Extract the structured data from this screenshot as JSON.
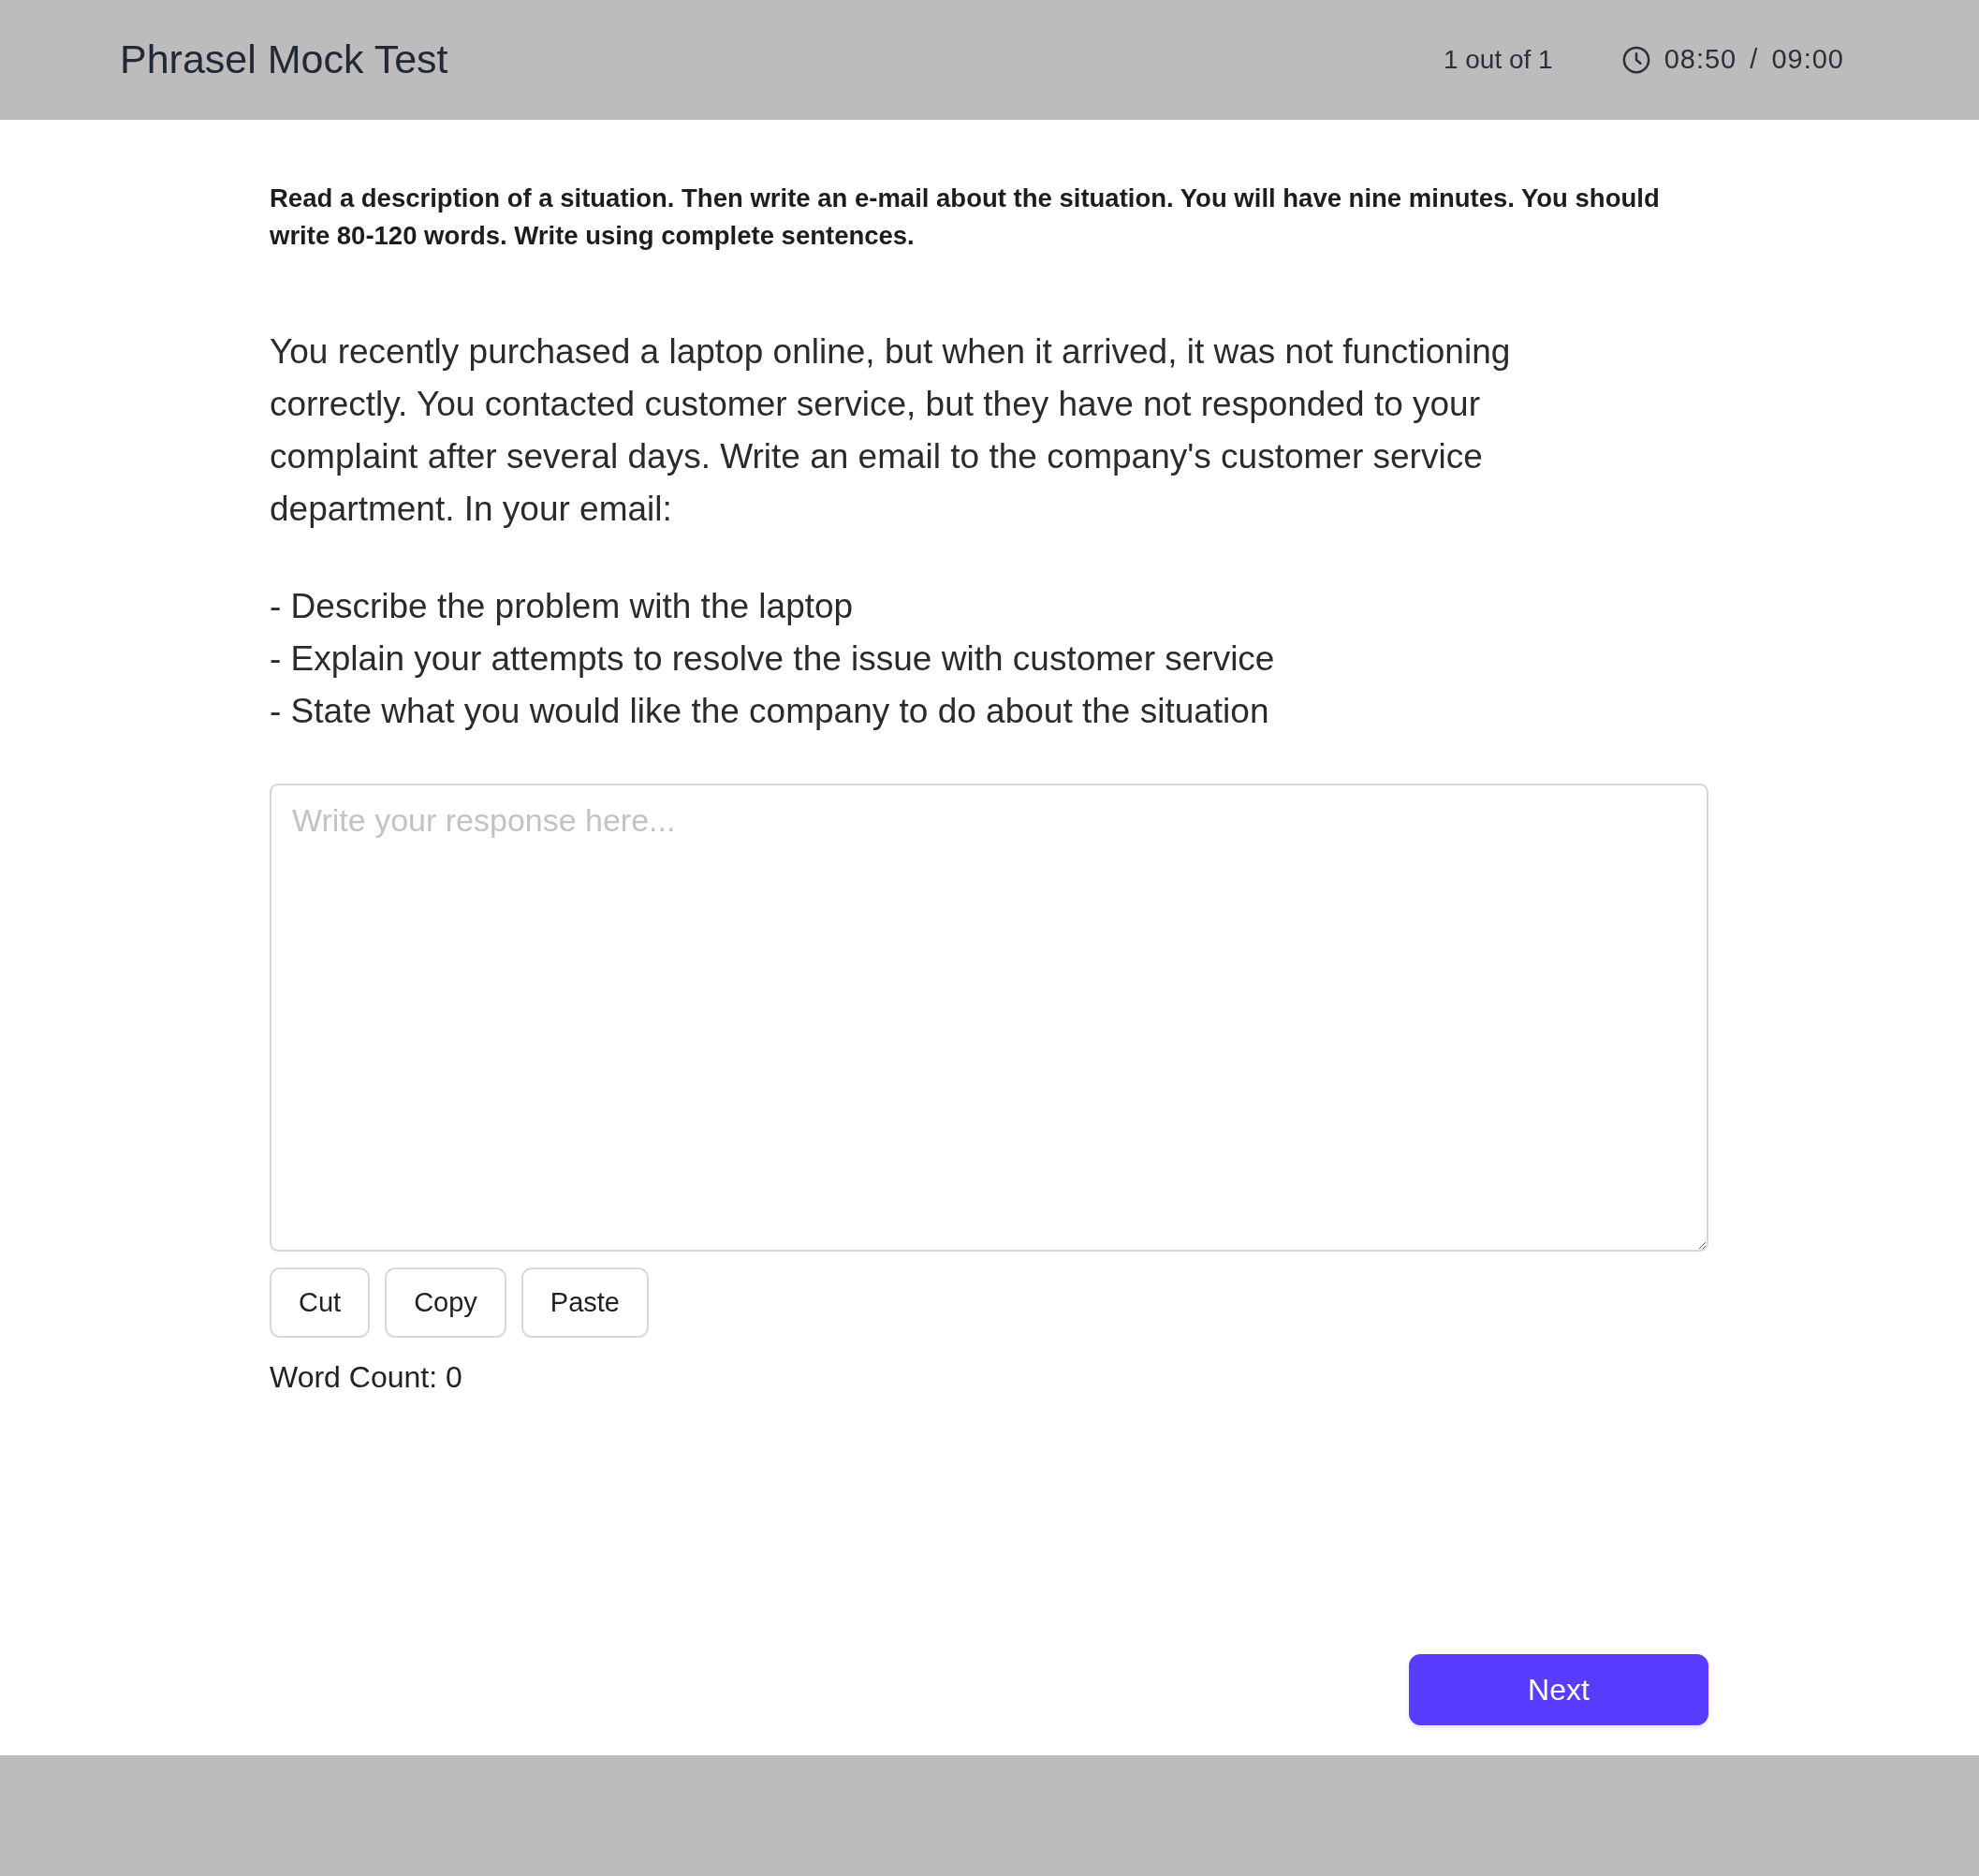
{
  "header": {
    "title": "Phrasel Mock Test",
    "progress": "1 out of 1",
    "timer": "08:50 / 09:00"
  },
  "task": {
    "instructions": "Read a description of a situation. Then write an e-mail about the situation. You will have nine minutes. You should write 80-120 words. Write using complete sentences.",
    "prompt": "You recently purchased a laptop online, but when it arrived, it was not functioning correctly. You contacted customer service, but they have not responded to your complaint after several days. Write an email to the company's customer service department. In your email:",
    "bullets": [
      "- Describe the problem with the laptop",
      "- Explain your attempts to resolve the issue with customer service",
      "- State what you would like the company to do about the situation"
    ]
  },
  "response": {
    "placeholder": "Write your response here..."
  },
  "edit_buttons": [
    "Cut",
    "Copy",
    "Paste"
  ],
  "word_count": "Word Count: 0",
  "next_button": "Next"
}
